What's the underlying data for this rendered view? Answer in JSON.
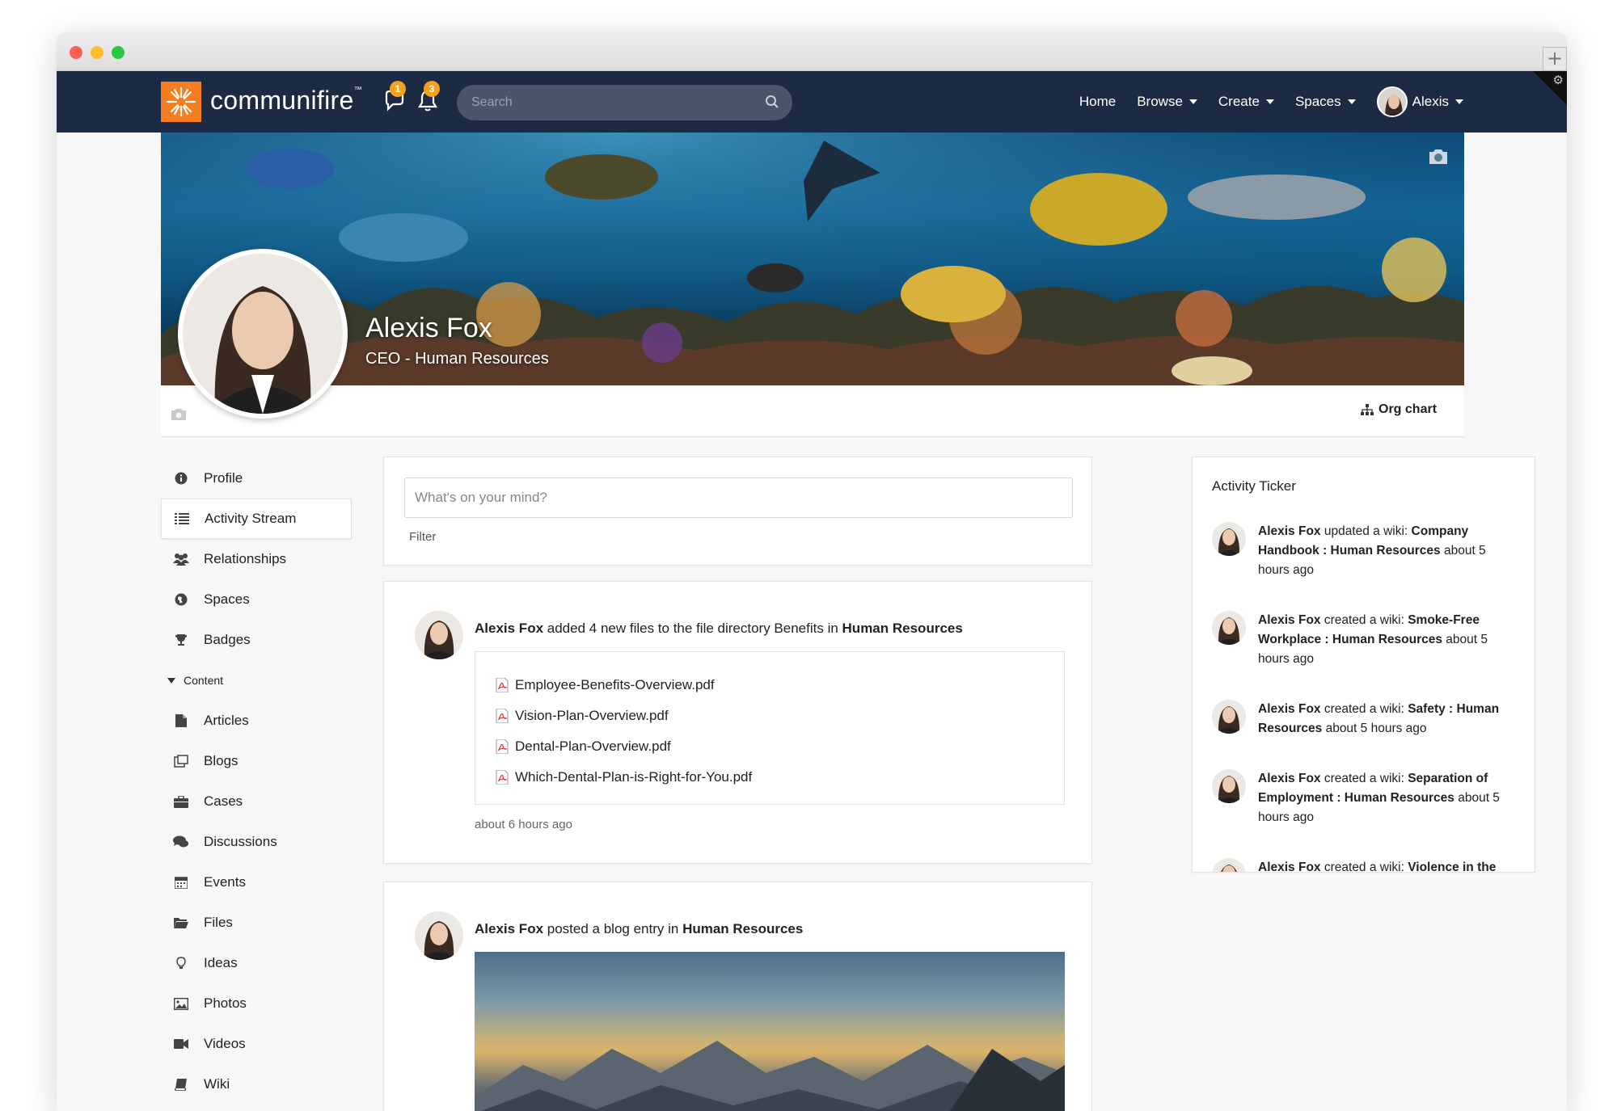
{
  "brand": {
    "name": "communifire",
    "trademark": "™",
    "color": "#f47d20"
  },
  "notifications": {
    "chat_count": "1",
    "bell_count": "3"
  },
  "search": {
    "placeholder": "Search"
  },
  "nav": {
    "home": "Home",
    "browse": "Browse",
    "create": "Create",
    "spaces": "Spaces",
    "user": "Alexis"
  },
  "profile": {
    "name": "Alexis Fox",
    "title": "CEO - Human Resources",
    "org_chart": "Org chart"
  },
  "sidebar": {
    "items": [
      {
        "label": "Profile",
        "icon": "info-icon"
      },
      {
        "label": "Activity Stream",
        "icon": "list-icon"
      },
      {
        "label": "Relationships",
        "icon": "users-icon"
      },
      {
        "label": "Spaces",
        "icon": "globe-icon"
      },
      {
        "label": "Badges",
        "icon": "trophy-icon"
      }
    ],
    "section": "Content",
    "content_items": [
      {
        "label": "Articles",
        "icon": "file-icon"
      },
      {
        "label": "Blogs",
        "icon": "blog-icon"
      },
      {
        "label": "Cases",
        "icon": "briefcase-icon"
      },
      {
        "label": "Discussions",
        "icon": "comments-icon"
      },
      {
        "label": "Events",
        "icon": "calendar-icon"
      },
      {
        "label": "Files",
        "icon": "folder-icon"
      },
      {
        "label": "Ideas",
        "icon": "lightbulb-icon"
      },
      {
        "label": "Photos",
        "icon": "image-icon"
      },
      {
        "label": "Videos",
        "icon": "video-icon"
      },
      {
        "label": "Wiki",
        "icon": "book-icon"
      }
    ]
  },
  "composer": {
    "placeholder": "What's on your mind?",
    "filter": "Filter"
  },
  "posts": [
    {
      "author": "Alexis Fox",
      "action": " added 4 new files to the file directory Benefits in ",
      "target": "Human Resources",
      "files": [
        "Employee-Benefits-Overview.pdf",
        "Vision-Plan-Overview.pdf",
        "Dental-Plan-Overview.pdf",
        "Which-Dental-Plan-is-Right-for-You.pdf"
      ],
      "time": "about 6 hours ago"
    },
    {
      "author": "Alexis Fox",
      "action": " posted a blog entry in ",
      "target": "Human Resources"
    }
  ],
  "ticker": {
    "title": "Activity Ticker",
    "entries": [
      {
        "author": "Alexis Fox",
        "action": " updated a wiki: ",
        "item": "Company Handbook : Human Resources",
        "time": " about 5 hours ago"
      },
      {
        "author": "Alexis Fox",
        "action": " created a wiki: ",
        "item": "Smoke-Free Workplace : Human Resources",
        "time": " about 5 hours ago"
      },
      {
        "author": "Alexis Fox",
        "action": " created a wiki: ",
        "item": "Safety : Human Resources",
        "time": " about 5 hours ago"
      },
      {
        "author": "Alexis Fox",
        "action": " created a wiki: ",
        "item": "Separation of Employment : Human Resources",
        "time": " about 5 hours ago"
      },
      {
        "author": "Alexis Fox",
        "action": " created a wiki: ",
        "item": "Violence in the",
        "time": ""
      }
    ]
  }
}
